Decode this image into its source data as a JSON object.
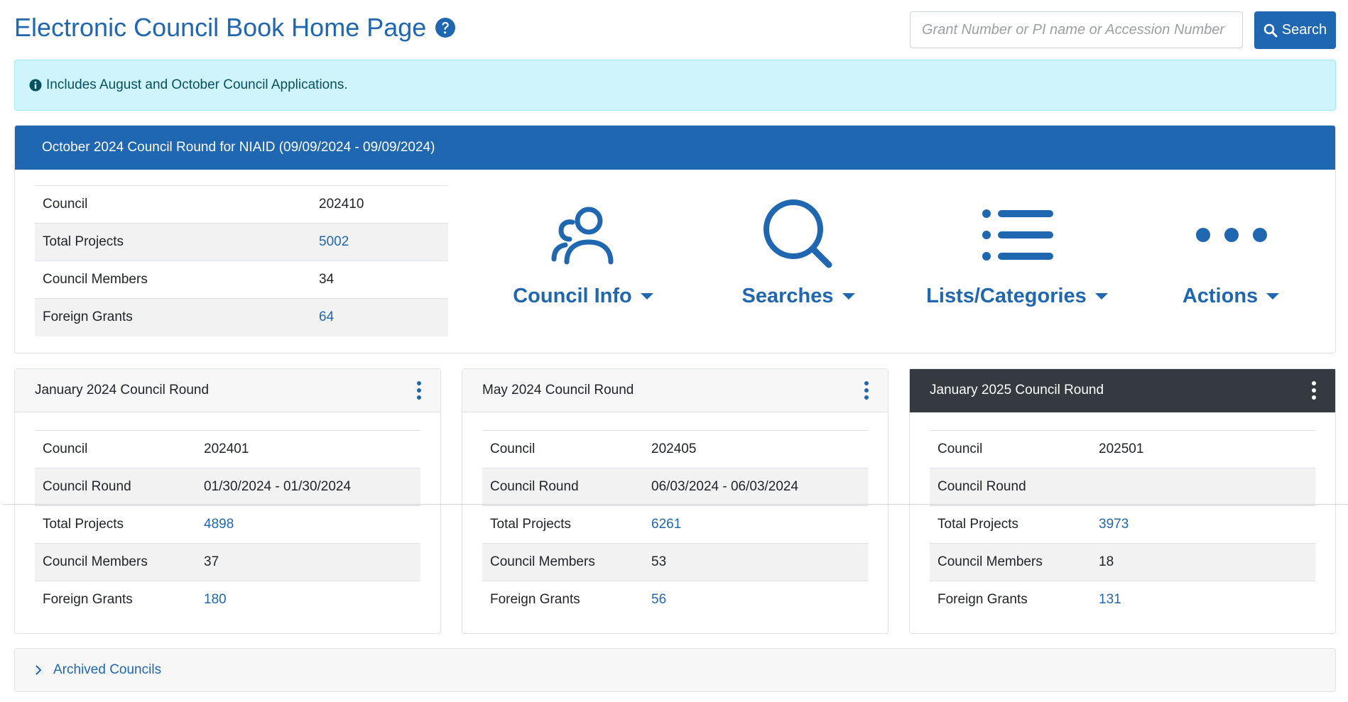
{
  "header": {
    "title": "Electronic Council Book Home Page",
    "search_placeholder": "Grant Number or PI name or Accession Number",
    "search_label": "Search"
  },
  "alert": {
    "text": "Includes August and October Council Applications."
  },
  "current_round": {
    "title": "October 2024 Council Round for NIAID (09/09/2024 - 09/09/2024)",
    "rows": [
      {
        "label": "Council",
        "value": "202410"
      },
      {
        "label": "Total Projects",
        "value": "5002"
      },
      {
        "label": "Council Members",
        "value": "34"
      },
      {
        "label": "Foreign Grants",
        "value": "64"
      }
    ]
  },
  "menus": [
    {
      "label": "Council Info",
      "icon": "people-icon"
    },
    {
      "label": "Searches",
      "icon": "magnifier-icon"
    },
    {
      "label": "Lists/Categories",
      "icon": "list-icon"
    },
    {
      "label": "Actions",
      "icon": "ellipsis-icon"
    }
  ],
  "rounds": [
    {
      "title": "January 2024 Council Round",
      "rows": [
        {
          "label": "Council",
          "value": "202401"
        },
        {
          "label": "Council Round",
          "value": "01/30/2024 - 01/30/2024"
        },
        {
          "label": "Total Projects",
          "value": "4898"
        },
        {
          "label": "Council Members",
          "value": "37"
        },
        {
          "label": "Foreign Grants",
          "value": "180"
        }
      ]
    },
    {
      "title": "May 2024 Council Round",
      "rows": [
        {
          "label": "Council",
          "value": "202405"
        },
        {
          "label": "Council Round",
          "value": "06/03/2024 - 06/03/2024"
        },
        {
          "label": "Total Projects",
          "value": "6261"
        },
        {
          "label": "Council Members",
          "value": "53"
        },
        {
          "label": "Foreign Grants",
          "value": "56"
        }
      ]
    },
    {
      "title": "January 2025 Council Round",
      "rows": [
        {
          "label": "Council",
          "value": "202501"
        },
        {
          "label": "Council Round",
          "value": ""
        },
        {
          "label": "Total Projects",
          "value": "3973"
        },
        {
          "label": "Council Members",
          "value": "18"
        },
        {
          "label": "Foreign Grants",
          "value": "131"
        }
      ]
    }
  ],
  "archived": {
    "label": "Archived Councils"
  },
  "colors": {
    "primary": "#1f67b1",
    "alert_bg": "#cff4fc",
    "dark_header": "#343a40"
  }
}
